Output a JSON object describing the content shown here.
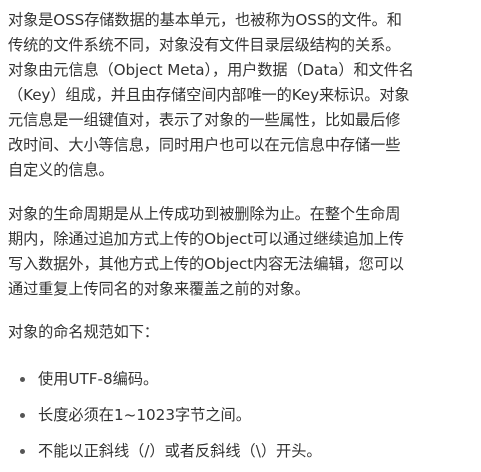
{
  "paragraphs": [
    {
      "lines": [
        "对象是OSS存储数据的基本单元，也被称为OSS的文件。和",
        "传统的文件系统不同，对象没有文件目录层级结构的关系。",
        "对象由元信息（Object Meta），用户数据（Data）和文件名",
        "（Key）组成，并且由存储空间内部唯一的Key来标识。对象",
        "元信息是一组键值对，表示了对象的一些属性，比如最后修",
        "改时间、大小等信息，同时用户也可以在元信息中存储一些",
        "自定义的信息。"
      ]
    },
    {
      "lines": [
        "对象的生命周期是从上传成功到被删除为止。在整个生命周",
        "期内，除通过追加方式上传的Object可以通过继续追加上传",
        "写入数据外，其他方式上传的Object内容无法编辑，您可以",
        "通过重复上传同名的对象来覆盖之前的对象。"
      ]
    },
    {
      "lines": [
        "对象的命名规范如下："
      ]
    }
  ],
  "bullets": [
    "使用UTF-8编码。",
    "长度必须在1~1023字节之间。",
    "不能以正斜线（/）或者反斜线（\\）开头。"
  ]
}
